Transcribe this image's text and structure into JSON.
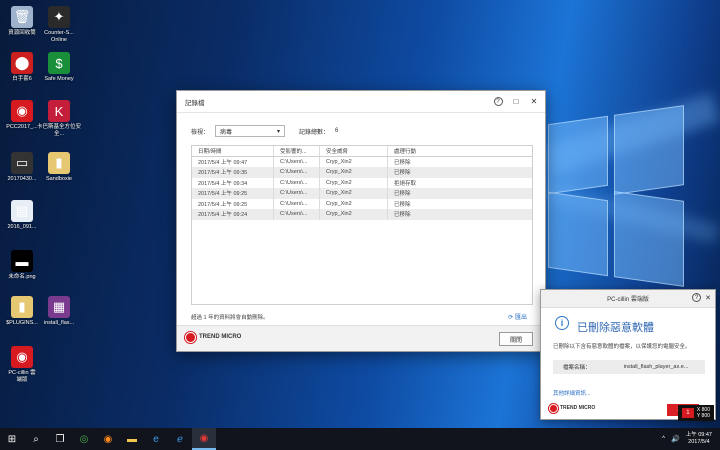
{
  "desktop_icons": [
    {
      "label": "資源回收筒",
      "glyph": "🗑",
      "color": "#9fb4cc"
    },
    {
      "label": "Counter-S...\nOnline",
      "glyph": "✦",
      "color": "#2a2a2a"
    },
    {
      "label": "白手套6",
      "glyph": "⬤",
      "color": "#cc1f1f"
    },
    {
      "label": "Safe Money",
      "glyph": "$",
      "color": "#1a8f3a"
    },
    {
      "label": "PCC2017_...",
      "glyph": "◉",
      "color": "#d71920"
    },
    {
      "label": "卡巴斯基全方位安全...",
      "glyph": "K",
      "color": "#c41e3a"
    },
    {
      "label": "20170430...",
      "glyph": "▭",
      "color": "#333333"
    },
    {
      "label": "Sandboxie",
      "glyph": "▮",
      "color": "#e6c873"
    },
    {
      "label": "2016_091...",
      "glyph": "▤",
      "color": "#e8eef6"
    },
    {
      "label": "未命名.png",
      "glyph": "▬",
      "color": "#000000"
    },
    {
      "label": "$PLUGINS...",
      "glyph": "▮",
      "color": "#e6c873"
    },
    {
      "label": "install_flas...",
      "glyph": "▦",
      "color": "#7a3b8f"
    },
    {
      "label": "PC-cillin 雲\n端版",
      "glyph": "◉",
      "color": "#d71920"
    }
  ],
  "log_window": {
    "title": "記錄檔",
    "help": "?",
    "maximize": "□",
    "close": "✕",
    "filter_label": "檢視：",
    "filter_value": "病毒",
    "dropdown_arrow": "▾",
    "total_label": "記錄總數：",
    "total_value": "6",
    "columns": [
      "日期/時間",
      "受影響的...",
      "安全威脅",
      "處理行動"
    ],
    "rows": [
      [
        "2017/5/4 上午 09:47",
        "C:\\Users\\...",
        "Cryp_Xin2",
        "已移除"
      ],
      [
        "2017/5/4 上午 09:35",
        "C:\\Users\\...",
        "Cryp_Xin2",
        "已移除"
      ],
      [
        "2017/5/4 上午 09:34",
        "C:\\Users\\...",
        "Cryp_Xin2",
        "拒絕存取"
      ],
      [
        "2017/5/4 上午 09:25",
        "C:\\Users\\...",
        "Cryp_Xin2",
        "已移除"
      ],
      [
        "2017/5/4 上午 09:25",
        "C:\\Users\\...",
        "Cryp_Xin2",
        "已移除"
      ],
      [
        "2017/5/4 上午 09:24",
        "C:\\Users\\...",
        "Cryp_Xin2",
        "已移除"
      ]
    ],
    "footer_note": "超過 1 年的資料將會自動刪除。",
    "export_label": "匯出",
    "export_icon": "⟳",
    "logo_text": "TREND MICRO",
    "close_button": "關閉"
  },
  "popup": {
    "title": "PC-cillin 雲端版",
    "help": "?",
    "close": "✕",
    "info_glyph": "i",
    "heading": "已刪除惡意軟體",
    "description": "已刪除以下含有惡意軟體的檔案，以保護您的電腦安全。",
    "file_label": "檔案名稱：",
    "file_value": "install_flash_player_ax.e...",
    "more_link": "其他詳細資訊...",
    "ok_button": "確定",
    "logo_text": "TREND MICRO"
  },
  "taskbar": {
    "items": [
      {
        "name": "start-button",
        "glyph": "⊞"
      },
      {
        "name": "search-icon",
        "glyph": "⌕"
      },
      {
        "name": "task-view-icon",
        "glyph": "❐"
      },
      {
        "name": "chrome-icon",
        "glyph": "◎"
      },
      {
        "name": "firefox-icon",
        "glyph": "◉"
      },
      {
        "name": "explorer-icon",
        "glyph": "▬"
      },
      {
        "name": "edge-icon",
        "glyph": "e"
      },
      {
        "name": "ie-icon",
        "glyph": "ℯ"
      },
      {
        "name": "pc-cillin-icon",
        "glyph": "◉"
      }
    ],
    "time": "上午 09:47",
    "date": "2017/5/4",
    "tray_arrow": "^",
    "tray_volume": "🔊"
  },
  "coord_overlay": {
    "badge": "1",
    "x": "X 800",
    "y": "Y 800"
  }
}
